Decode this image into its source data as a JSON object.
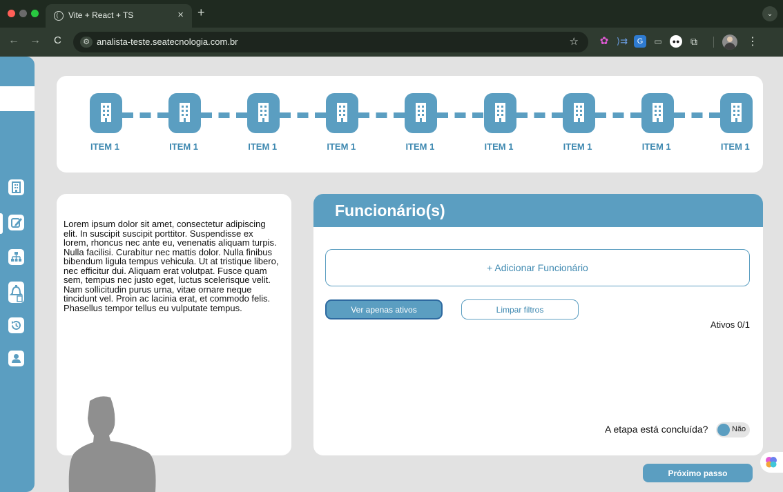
{
  "browser": {
    "tab_title": "Vite + React + TS",
    "tab_close": "×",
    "new_tab": "+",
    "tab_menu": "⌄",
    "url": "analista-teste.seatecnologia.com.br",
    "nav_back": "←",
    "nav_forward": "→",
    "nav_reload": "C",
    "site_info": "⚙",
    "star": "☆",
    "menu": "⋮",
    "icons": [
      "site-info-icon",
      "bookmark-star-icon",
      "extension-icons",
      "profile-avatar",
      "kebab-menu-icon"
    ]
  },
  "sidebar": {
    "items": [
      {
        "icon": "building-icon",
        "glyph": "▦"
      },
      {
        "icon": "edit-icon",
        "glyph": "✎"
      },
      {
        "icon": "org-chart-icon",
        "glyph": "♣"
      },
      {
        "icon": "bell-document-icon",
        "glyph": "♪"
      },
      {
        "icon": "history-icon",
        "glyph": "↺"
      },
      {
        "icon": "user-icon",
        "glyph": "●"
      }
    ],
    "active_index": 1
  },
  "stepper": {
    "steps": [
      {
        "label": "ITEM 1",
        "icon": "building-icon"
      },
      {
        "label": "ITEM 1",
        "icon": "building-icon"
      },
      {
        "label": "ITEM 1",
        "icon": "building-icon"
      },
      {
        "label": "ITEM 1",
        "icon": "building-icon"
      },
      {
        "label": "ITEM 1",
        "icon": "building-icon"
      },
      {
        "label": "ITEM 1",
        "icon": "building-icon"
      },
      {
        "label": "ITEM 1",
        "icon": "building-icon"
      },
      {
        "label": "ITEM 1",
        "icon": "building-icon"
      },
      {
        "label": "ITEM 1",
        "icon": "building-icon"
      }
    ]
  },
  "description": {
    "text": "Lorem ipsum dolor sit amet, consectetur adipiscing elit. In suscipit suscipit porttitor. Suspendisse ex lorem, rhoncus nec ante eu, venenatis aliquam turpis. Nulla facilisi. Curabitur nec mattis dolor. Nulla finibus bibendum ligula tempus vehicula. Ut at tristique libero, nec efficitur dui. Aliquam erat volutpat. Fusce quam sem, tempus nec justo eget, luctus scelerisque velit. Nam sollicitudin purus urna, vitae ornare neque tincidunt vel. Proin ac lacinia erat, et commodo felis. Phasellus tempor tellus eu vulputate tempus."
  },
  "employees": {
    "title": "Funcionário(s)",
    "add_button": "+ Adicionar Funcionário",
    "filter_active": "Ver apenas ativos",
    "filter_clear": "Limpar filtros",
    "active_count": "Ativos 0/1",
    "stage_question": "A etapa está concluída?",
    "stage_toggle_label": "Não",
    "stage_complete": false
  },
  "footer": {
    "next_button": "Próximo passo"
  },
  "colors": {
    "primary": "#5b9ec1",
    "primary_text": "#3d88b0",
    "background": "#e2e2e2",
    "card": "#ffffff"
  }
}
